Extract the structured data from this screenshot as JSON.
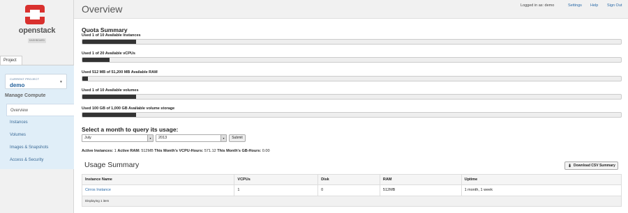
{
  "logo": {
    "name": "openstack",
    "sub": "DASHBOARD"
  },
  "sidebar": {
    "tab": "Project",
    "current_project_label": "CURRENT PROJECT",
    "current_project": "demo",
    "section_title": "Manage Compute",
    "items": [
      {
        "label": "Overview"
      },
      {
        "label": "Instances"
      },
      {
        "label": "Volumes"
      },
      {
        "label": "Images & Snapshots"
      },
      {
        "label": "Access & Security"
      }
    ]
  },
  "header": {
    "title": "Overview",
    "logged_in": "Logged in as: demo",
    "settings": "Settings",
    "help": "Help",
    "sign_out": "Sign Out"
  },
  "quota": {
    "title": "Quota Summary",
    "items": [
      {
        "label": "Used 1 of 10 Available Instances",
        "fraction": 0.1
      },
      {
        "label": "Used 1 of 20 Available vCPUs",
        "fraction": 0.05
      },
      {
        "label": "Used 512 MB of 51,200 MB Available RAM",
        "fraction": 0.01
      },
      {
        "label": "Used 1 of 10 Available volumes",
        "fraction": 0.1
      },
      {
        "label": "Used 100 GB of 1,000 GB Available volume storage",
        "fraction": 0.1
      }
    ]
  },
  "usage_query": {
    "title": "Select a month to query its usage:",
    "month": "July",
    "year": "2013",
    "submit": "Submit"
  },
  "stats": {
    "active_instances_label": "Active Instances:",
    "active_instances": "1",
    "active_ram_label": "Active RAM:",
    "active_ram": "512MB",
    "vcpu_hours_label": "This Month's VCPU-Hours:",
    "vcpu_hours": "571.12",
    "gb_hours_label": "This Month's GB-Hours:",
    "gb_hours": "0.00"
  },
  "usage": {
    "title": "Usage Summary",
    "csv_button": "Download CSV Summary",
    "columns": [
      "Instance Name",
      "VCPUs",
      "Disk",
      "RAM",
      "Uptime"
    ],
    "rows": [
      [
        "Cirros Instance",
        "1",
        "0",
        "512MB",
        "1 month, 1 week"
      ]
    ],
    "footer": "Displaying 1 item"
  }
}
